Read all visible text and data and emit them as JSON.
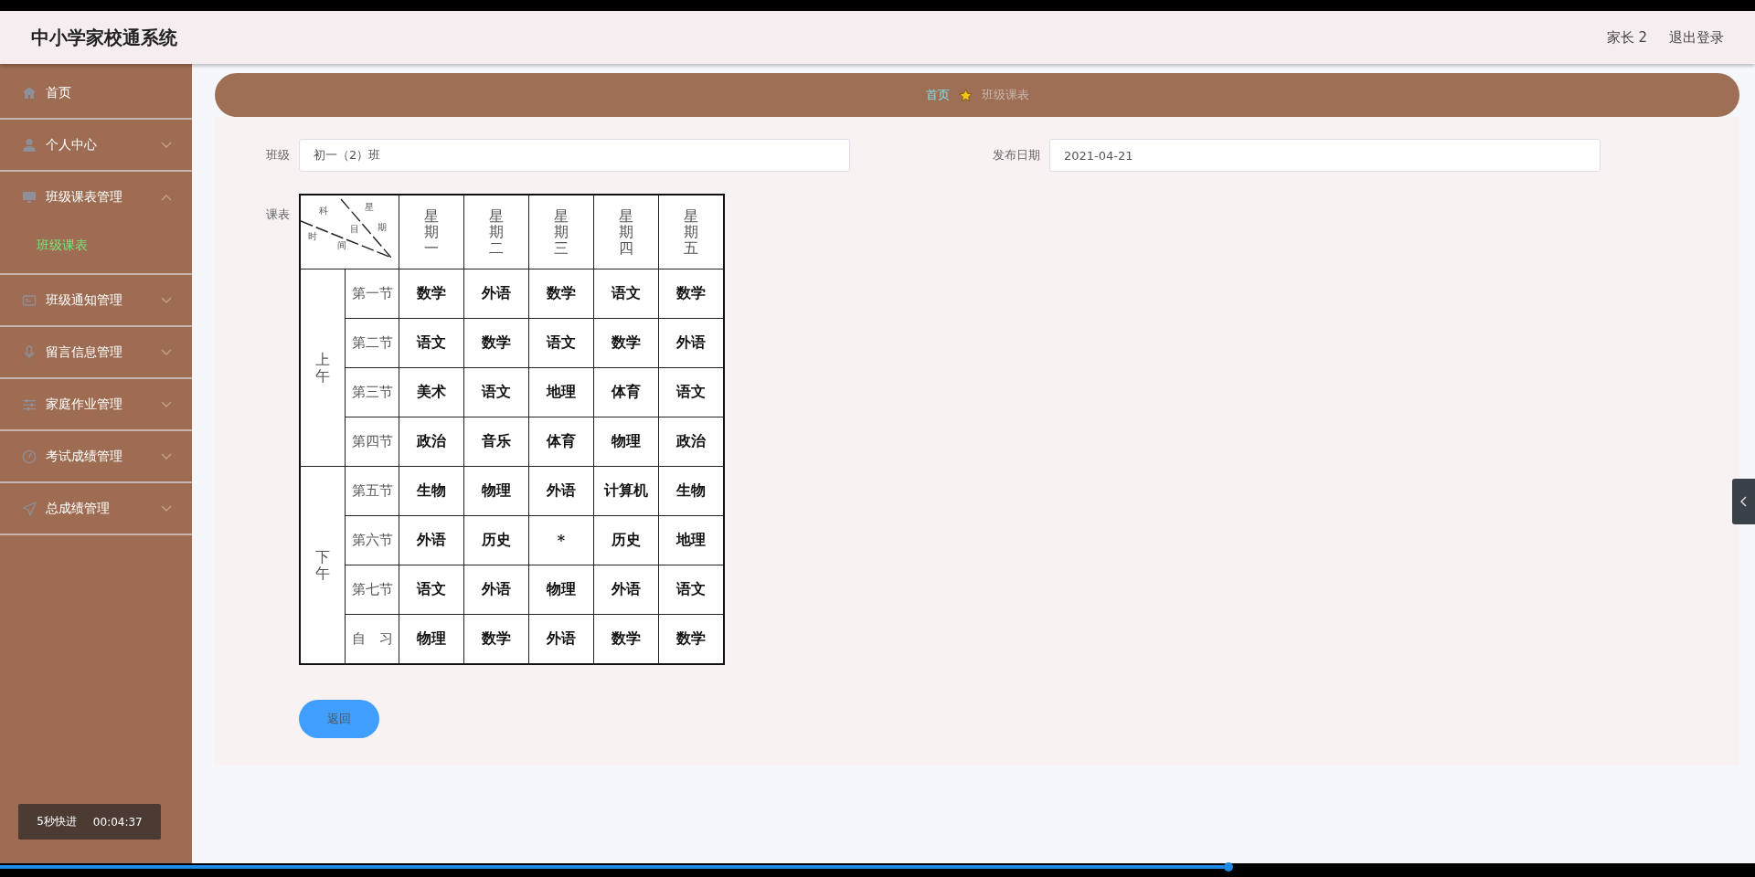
{
  "header": {
    "title": "中小学家校通系统",
    "user": "家长 2",
    "logout": "退出登录"
  },
  "sidebar": {
    "items": [
      {
        "label": "首页",
        "kind": "link"
      },
      {
        "label": "个人中心",
        "kind": "menu",
        "expanded": false
      },
      {
        "label": "班级课表管理",
        "kind": "menu",
        "expanded": true,
        "children": [
          {
            "label": "班级课表",
            "selected": true
          }
        ]
      },
      {
        "label": "班级通知管理",
        "kind": "menu",
        "expanded": false
      },
      {
        "label": "留言信息管理",
        "kind": "menu",
        "expanded": false
      },
      {
        "label": "家庭作业管理",
        "kind": "menu",
        "expanded": false
      },
      {
        "label": "考试成绩管理",
        "kind": "menu",
        "expanded": false
      },
      {
        "label": "总成绩管理",
        "kind": "menu",
        "expanded": false
      }
    ]
  },
  "breadcrumb": [
    {
      "label": "首页",
      "kind": "link"
    },
    {
      "label": "班级课表",
      "kind": "current"
    }
  ],
  "form": {
    "fields": [
      {
        "label": "班级",
        "value": "初一（2）班"
      },
      {
        "label": "发布日期",
        "value": "2021-04-21"
      }
    ],
    "schedule": {
      "label": "课表",
      "corner": [
        "科",
        "星",
        "期",
        "目",
        "时",
        "间"
      ],
      "days": [
        "星期一",
        "星期二",
        "星期三",
        "星期四",
        "星期五"
      ],
      "sessions": [
        {
          "label": "上午",
          "periods": [
            {
              "label": "第一节",
              "subjects": [
                "数学",
                "外语",
                "数学",
                "语文",
                "数学"
              ]
            },
            {
              "label": "第二节",
              "subjects": [
                "语文",
                "数学",
                "语文",
                "数学",
                "外语"
              ]
            },
            {
              "label": "第三节",
              "subjects": [
                "美术",
                "语文",
                "地理",
                "体育",
                "语文"
              ]
            },
            {
              "label": "第四节",
              "subjects": [
                "政治",
                "音乐",
                "体育",
                "物理",
                "政治"
              ]
            }
          ]
        },
        {
          "label": "下午",
          "periods": [
            {
              "label": "第五节",
              "subjects": [
                "生物",
                "物理",
                "外语",
                "计算机",
                "生物"
              ]
            },
            {
              "label": "第六节",
              "subjects": [
                "外语",
                "历史",
                "*",
                "历史",
                "地理"
              ]
            },
            {
              "label": "第七节",
              "subjects": [
                "语文",
                "外语",
                "物理",
                "外语",
                "语文"
              ]
            },
            {
              "label": "自　习",
              "subjects": [
                "物理",
                "数学",
                "外语",
                "数学",
                "数学"
              ]
            }
          ]
        }
      ]
    },
    "back_button": "返回"
  },
  "player": {
    "skip": "5秒快进",
    "time": "00:04:37",
    "progress": {
      "level": 0.7
    }
  }
}
